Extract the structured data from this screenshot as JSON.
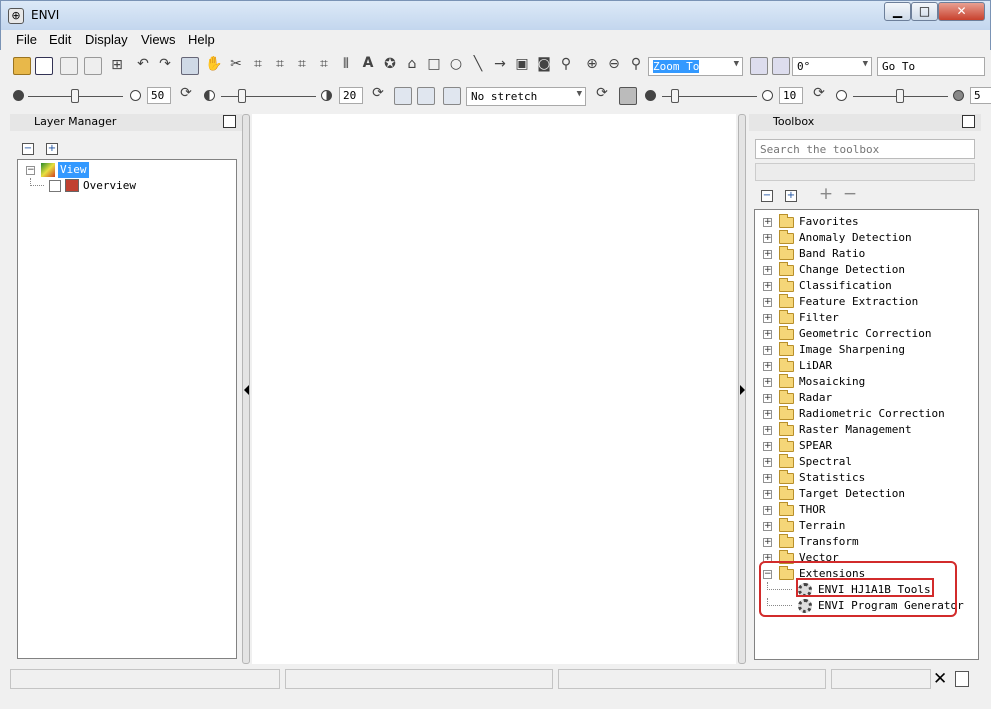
{
  "window": {
    "title": "ENVI",
    "buttons": {
      "minimize": "▁",
      "maximize": "□",
      "close": "✕"
    }
  },
  "menu": [
    "File",
    "Edit",
    "Display",
    "Views",
    "Help"
  ],
  "toolbar1": {
    "zoom_combo": "Zoom To",
    "rotation_combo": "0°",
    "goto_field": "Go To"
  },
  "toolbar2": {
    "brightness_value": "50",
    "contrast_value": "20",
    "stretch_combo": "No stretch",
    "sharpen_value": "10",
    "transparency_value": "5",
    "brightness_level": 0.5,
    "contrast_level": 0.2,
    "sharpen_level": 0.1,
    "transparency_level": 0.5
  },
  "layer_manager": {
    "title": "Layer Manager",
    "tree": [
      {
        "label": "View",
        "selected": true
      },
      {
        "label": "Overview",
        "selected": false
      }
    ]
  },
  "toolbox": {
    "title": "Toolbox",
    "search_placeholder": "Search the toolbox",
    "folders": [
      "Favorites",
      "Anomaly Detection",
      "Band Ratio",
      "Change Detection",
      "Classification",
      "Feature Extraction",
      "Filter",
      "Geometric Correction",
      "Image Sharpening",
      "LiDAR",
      "Mosaicking",
      "Radar",
      "Radiometric Correction",
      "Raster Management",
      "SPEAR",
      "Spectral",
      "Statistics",
      "Target Detection",
      "THOR",
      "Terrain",
      "Transform",
      "Vector",
      "Extensions"
    ],
    "extensions": [
      "ENVI_HJ1A1B_Tools",
      "ENVI Program Generator"
    ]
  },
  "status_bar": {
    "close_glyph": "✕"
  },
  "colors": {
    "selection": "#3399ff",
    "highlight": "#d22b2b",
    "folder": "#f5d678"
  }
}
